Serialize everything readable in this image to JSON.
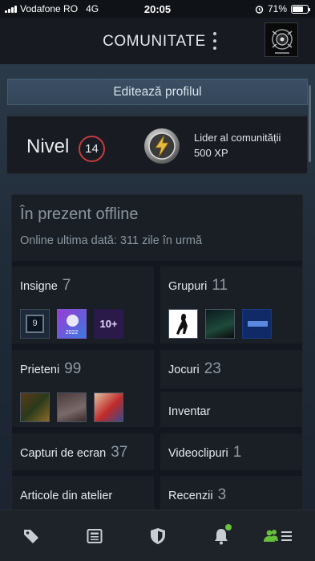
{
  "status_bar": {
    "carrier": "Vodafone RO",
    "network": "4G",
    "time": "20:05",
    "battery_percent": "71%",
    "battery_level": 0.71
  },
  "header": {
    "title": "COMUNITATE"
  },
  "profile": {
    "edit_button": "Editează profilul",
    "level_label": "Nivel",
    "level_value": "14",
    "xp_badge_name": "Lider al comunității",
    "xp_amount": "500 XP",
    "status_title": "În prezent offline",
    "status_sub": "Online ultima dată: 311 zile în urmă"
  },
  "tiles": {
    "badges": {
      "label": "Insigne",
      "count": "7",
      "thumbs": [
        "9",
        "2022",
        "10+"
      ]
    },
    "groups": {
      "label": "Grupuri",
      "count": "11"
    },
    "friends": {
      "label": "Prieteni",
      "count": "99"
    },
    "games": {
      "label": "Jocuri",
      "count": "23"
    },
    "inventory": {
      "label": "Inventar"
    },
    "screenshots": {
      "label": "Capturi de ecran",
      "count": "37"
    },
    "videos": {
      "label": "Videoclipuri",
      "count": "1"
    },
    "workshop": {
      "label": "Articole din atelier"
    },
    "reviews": {
      "label": "Recenzii",
      "count": "3"
    }
  },
  "nav": {
    "items": [
      "store-icon",
      "news-icon",
      "guard-icon",
      "notifications-icon",
      "community-icon"
    ],
    "active": "community-icon",
    "accent": "#67c13a"
  },
  "colors": {
    "background": "#1b2838",
    "level_ring": "#c63b3e",
    "accent_green": "#67c13a"
  }
}
